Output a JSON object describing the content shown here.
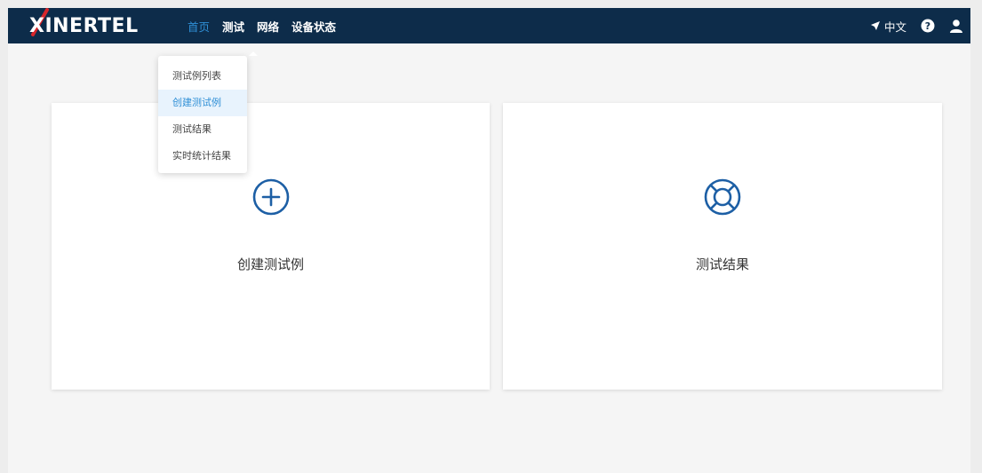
{
  "header": {
    "logo_text": "XINERTEL",
    "nav": [
      {
        "label": "首页",
        "active": true
      },
      {
        "label": "测试"
      },
      {
        "label": "网络"
      },
      {
        "label": "设备状态"
      }
    ],
    "language_label": "中文",
    "icons": [
      "send-icon",
      "help-icon",
      "user-icon"
    ]
  },
  "dropdown": {
    "items": [
      {
        "label": "测试例列表"
      },
      {
        "label": "创建测试例",
        "selected": true
      },
      {
        "label": "测试结果"
      },
      {
        "label": "实时统计结果"
      }
    ]
  },
  "cards": [
    {
      "label": "创建测试例",
      "icon": "plus-circle-icon"
    },
    {
      "label": "测试结果",
      "icon": "lifebuoy-icon"
    }
  ],
  "colors": {
    "header_bg": "#0d2c4a",
    "accent": "#2f8fd6",
    "logo_x_red": "#d8262b",
    "icon_blue": "#1d5fa5"
  }
}
